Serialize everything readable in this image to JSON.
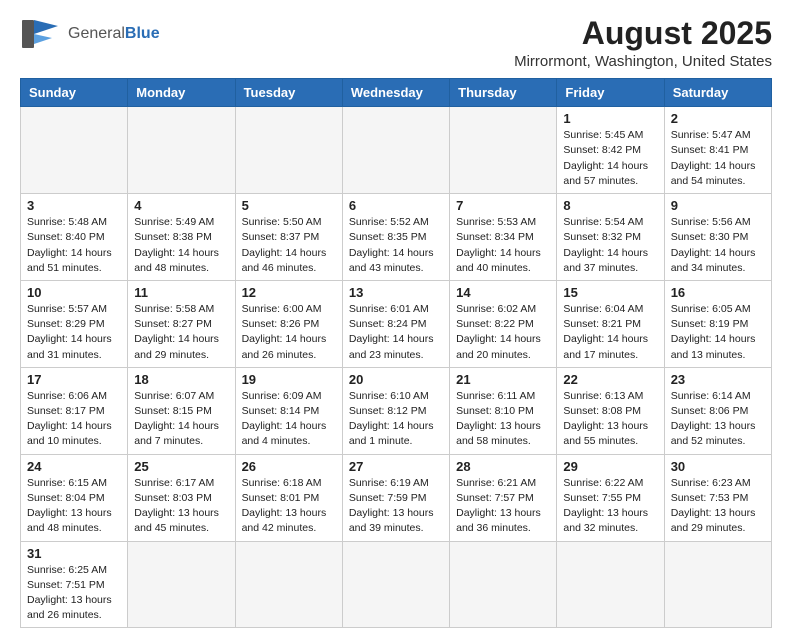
{
  "header": {
    "logo_general": "General",
    "logo_blue": "Blue",
    "title": "August 2025",
    "subtitle": "Mirrormont, Washington, United States"
  },
  "weekdays": [
    "Sunday",
    "Monday",
    "Tuesday",
    "Wednesday",
    "Thursday",
    "Friday",
    "Saturday"
  ],
  "weeks": [
    [
      {
        "day": "",
        "info": ""
      },
      {
        "day": "",
        "info": ""
      },
      {
        "day": "",
        "info": ""
      },
      {
        "day": "",
        "info": ""
      },
      {
        "day": "",
        "info": ""
      },
      {
        "day": "1",
        "info": "Sunrise: 5:45 AM\nSunset: 8:42 PM\nDaylight: 14 hours\nand 57 minutes."
      },
      {
        "day": "2",
        "info": "Sunrise: 5:47 AM\nSunset: 8:41 PM\nDaylight: 14 hours\nand 54 minutes."
      }
    ],
    [
      {
        "day": "3",
        "info": "Sunrise: 5:48 AM\nSunset: 8:40 PM\nDaylight: 14 hours\nand 51 minutes."
      },
      {
        "day": "4",
        "info": "Sunrise: 5:49 AM\nSunset: 8:38 PM\nDaylight: 14 hours\nand 48 minutes."
      },
      {
        "day": "5",
        "info": "Sunrise: 5:50 AM\nSunset: 8:37 PM\nDaylight: 14 hours\nand 46 minutes."
      },
      {
        "day": "6",
        "info": "Sunrise: 5:52 AM\nSunset: 8:35 PM\nDaylight: 14 hours\nand 43 minutes."
      },
      {
        "day": "7",
        "info": "Sunrise: 5:53 AM\nSunset: 8:34 PM\nDaylight: 14 hours\nand 40 minutes."
      },
      {
        "day": "8",
        "info": "Sunrise: 5:54 AM\nSunset: 8:32 PM\nDaylight: 14 hours\nand 37 minutes."
      },
      {
        "day": "9",
        "info": "Sunrise: 5:56 AM\nSunset: 8:30 PM\nDaylight: 14 hours\nand 34 minutes."
      }
    ],
    [
      {
        "day": "10",
        "info": "Sunrise: 5:57 AM\nSunset: 8:29 PM\nDaylight: 14 hours\nand 31 minutes."
      },
      {
        "day": "11",
        "info": "Sunrise: 5:58 AM\nSunset: 8:27 PM\nDaylight: 14 hours\nand 29 minutes."
      },
      {
        "day": "12",
        "info": "Sunrise: 6:00 AM\nSunset: 8:26 PM\nDaylight: 14 hours\nand 26 minutes."
      },
      {
        "day": "13",
        "info": "Sunrise: 6:01 AM\nSunset: 8:24 PM\nDaylight: 14 hours\nand 23 minutes."
      },
      {
        "day": "14",
        "info": "Sunrise: 6:02 AM\nSunset: 8:22 PM\nDaylight: 14 hours\nand 20 minutes."
      },
      {
        "day": "15",
        "info": "Sunrise: 6:04 AM\nSunset: 8:21 PM\nDaylight: 14 hours\nand 17 minutes."
      },
      {
        "day": "16",
        "info": "Sunrise: 6:05 AM\nSunset: 8:19 PM\nDaylight: 14 hours\nand 13 minutes."
      }
    ],
    [
      {
        "day": "17",
        "info": "Sunrise: 6:06 AM\nSunset: 8:17 PM\nDaylight: 14 hours\nand 10 minutes."
      },
      {
        "day": "18",
        "info": "Sunrise: 6:07 AM\nSunset: 8:15 PM\nDaylight: 14 hours\nand 7 minutes."
      },
      {
        "day": "19",
        "info": "Sunrise: 6:09 AM\nSunset: 8:14 PM\nDaylight: 14 hours\nand 4 minutes."
      },
      {
        "day": "20",
        "info": "Sunrise: 6:10 AM\nSunset: 8:12 PM\nDaylight: 14 hours\nand 1 minute."
      },
      {
        "day": "21",
        "info": "Sunrise: 6:11 AM\nSunset: 8:10 PM\nDaylight: 13 hours\nand 58 minutes."
      },
      {
        "day": "22",
        "info": "Sunrise: 6:13 AM\nSunset: 8:08 PM\nDaylight: 13 hours\nand 55 minutes."
      },
      {
        "day": "23",
        "info": "Sunrise: 6:14 AM\nSunset: 8:06 PM\nDaylight: 13 hours\nand 52 minutes."
      }
    ],
    [
      {
        "day": "24",
        "info": "Sunrise: 6:15 AM\nSunset: 8:04 PM\nDaylight: 13 hours\nand 48 minutes."
      },
      {
        "day": "25",
        "info": "Sunrise: 6:17 AM\nSunset: 8:03 PM\nDaylight: 13 hours\nand 45 minutes."
      },
      {
        "day": "26",
        "info": "Sunrise: 6:18 AM\nSunset: 8:01 PM\nDaylight: 13 hours\nand 42 minutes."
      },
      {
        "day": "27",
        "info": "Sunrise: 6:19 AM\nSunset: 7:59 PM\nDaylight: 13 hours\nand 39 minutes."
      },
      {
        "day": "28",
        "info": "Sunrise: 6:21 AM\nSunset: 7:57 PM\nDaylight: 13 hours\nand 36 minutes."
      },
      {
        "day": "29",
        "info": "Sunrise: 6:22 AM\nSunset: 7:55 PM\nDaylight: 13 hours\nand 32 minutes."
      },
      {
        "day": "30",
        "info": "Sunrise: 6:23 AM\nSunset: 7:53 PM\nDaylight: 13 hours\nand 29 minutes."
      }
    ],
    [
      {
        "day": "31",
        "info": "Sunrise: 6:25 AM\nSunset: 7:51 PM\nDaylight: 13 hours\nand 26 minutes."
      },
      {
        "day": "",
        "info": ""
      },
      {
        "day": "",
        "info": ""
      },
      {
        "day": "",
        "info": ""
      },
      {
        "day": "",
        "info": ""
      },
      {
        "day": "",
        "info": ""
      },
      {
        "day": "",
        "info": ""
      }
    ]
  ]
}
